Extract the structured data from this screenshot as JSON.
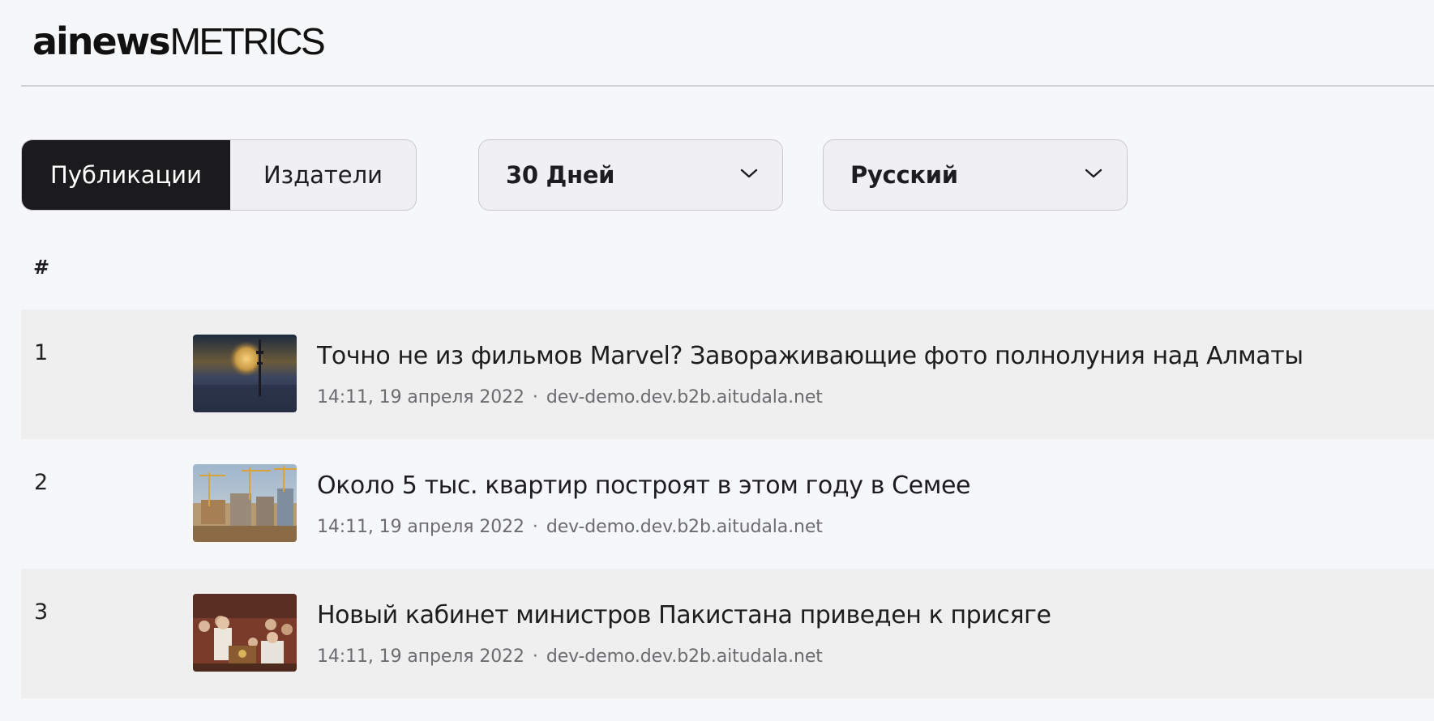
{
  "brand": {
    "logo_main": "ainews",
    "logo_sub": "METRICS"
  },
  "tabs": [
    {
      "label": "Публикации",
      "active": true
    },
    {
      "label": "Издатели",
      "active": false
    }
  ],
  "filters": {
    "period": {
      "selected": "30 Дней"
    },
    "language": {
      "selected": "Русский"
    }
  },
  "table": {
    "rank_header": "#",
    "rows": [
      {
        "rank": "1",
        "title": "Точно не из фильмов Marvel? Завораживающие фото полнолуния над Алматы",
        "time": "14:11, 19 апреля 2022",
        "separator": "·",
        "source": "dev-demo.dev.b2b.aitudala.net"
      },
      {
        "rank": "2",
        "title": "Около 5 тыс. квартир построят в этом году в Семее",
        "time": "14:11, 19 апреля 2022",
        "separator": "·",
        "source": "dev-demo.dev.b2b.aitudala.net"
      },
      {
        "rank": "3",
        "title": "Новый кабинет министров Пакистана приведен к присяге",
        "time": "14:11, 19 апреля 2022",
        "separator": "·",
        "source": "dev-demo.dev.b2b.aitudala.net"
      }
    ]
  },
  "colors": {
    "background": "#f6f7f9",
    "row_shade": "#efeff0",
    "active_tab": "#1b1b1d",
    "meta_text": "#6b6b70"
  }
}
